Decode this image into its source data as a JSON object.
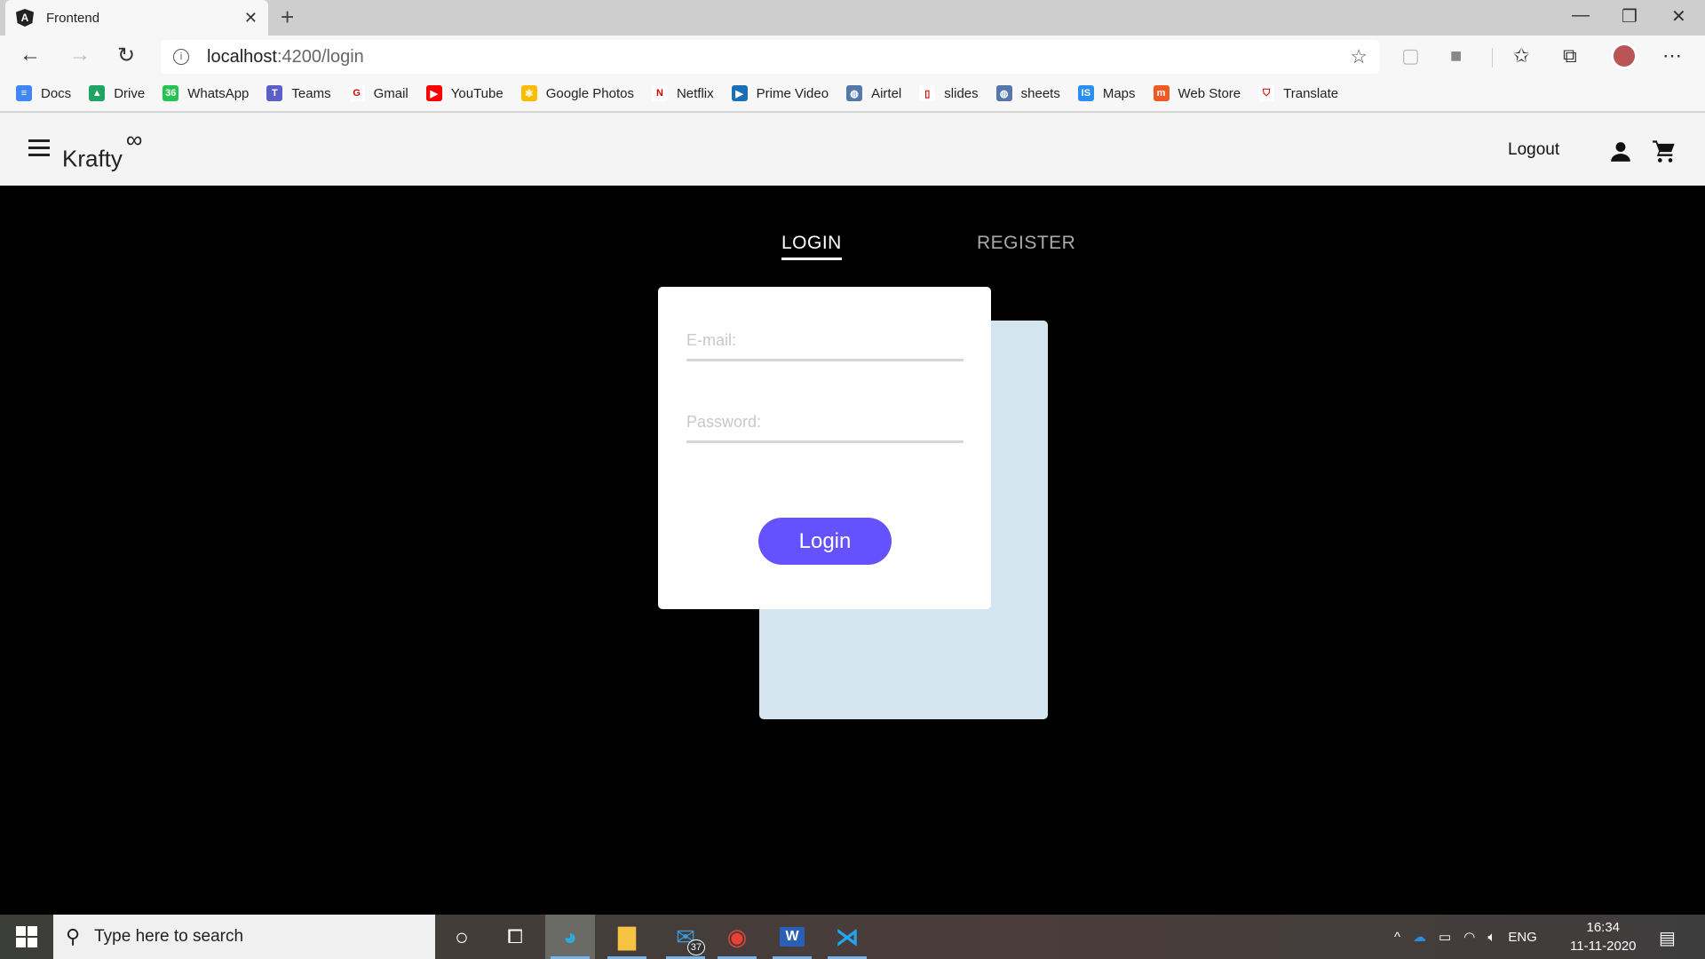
{
  "browser": {
    "tab_title": "Frontend",
    "url_host": "localhost",
    "url_path": ":4200/login",
    "bookmarks": [
      {
        "label": "Docs",
        "color": "#4285f4",
        "glyph": "≡"
      },
      {
        "label": "Drive",
        "color": "#1fa463",
        "glyph": "▲"
      },
      {
        "label": "WhatsApp",
        "color": "#25c450",
        "glyph": "36"
      },
      {
        "label": "Teams",
        "color": "#5b5fc7",
        "glyph": "T"
      },
      {
        "label": "Gmail",
        "color": "#ffffff",
        "glyph": "G"
      },
      {
        "label": "YouTube",
        "color": "#ff0000",
        "glyph": "▶"
      },
      {
        "label": "Google Photos",
        "color": "#fbbc05",
        "glyph": "✻"
      },
      {
        "label": "Netflix",
        "color": "#ffffff",
        "glyph": "N"
      },
      {
        "label": "Prime Video",
        "color": "#1a6fb5",
        "glyph": "▶"
      },
      {
        "label": "Airtel",
        "color": "#5577aa",
        "glyph": "◍"
      },
      {
        "label": "slides",
        "color": "#ffffff",
        "glyph": "▯"
      },
      {
        "label": "sheets",
        "color": "#5577aa",
        "glyph": "◍"
      },
      {
        "label": "Maps",
        "color": "#2b8ef0",
        "glyph": "IS"
      },
      {
        "label": "Web Store",
        "color": "#f05a22",
        "glyph": "m"
      },
      {
        "label": "Translate",
        "color": "#ffffff",
        "glyph": "⛉"
      }
    ]
  },
  "app": {
    "brand": "Krafty",
    "brand_mark": "∞",
    "logout_label": "Logout",
    "tabs": {
      "login": "LOGIN",
      "register": "REGISTER"
    },
    "form": {
      "email_placeholder": "E-mail:",
      "password_placeholder": "Password:",
      "submit_label": "Login"
    },
    "colors": {
      "accent": "#6352fd",
      "back_card": "#d5e5f0"
    }
  },
  "taskbar": {
    "search_placeholder": "Type here to search",
    "mail_badge": "37",
    "language": "ENG",
    "time": "16:34",
    "date": "11-11-2020",
    "word_glyph": "W"
  }
}
